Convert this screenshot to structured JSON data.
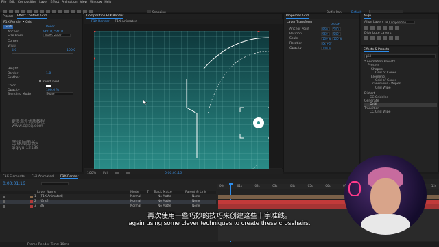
{
  "menu": [
    "File",
    "Edit",
    "Composition",
    "Layer",
    "Effect",
    "Animation",
    "View",
    "Window",
    "Help"
  ],
  "toolbar": {
    "snapping": "Snapping",
    "workspace": "Buffer Pan",
    "search": "search",
    "default_label": "Default"
  },
  "effects_panel": {
    "tabs": [
      "Project",
      "Effect Controls Grid"
    ],
    "header": "F1X Render • Grid",
    "reset": "Reset",
    "rows": [
      {
        "label": "Grid",
        "value": "Reset",
        "accent": true
      },
      {
        "label": "Anchor",
        "value": "960.0, 540.0"
      },
      {
        "label": "Size From",
        "value": "Width Slider"
      },
      {
        "label": "Corner",
        "value": ""
      },
      {
        "label": "Width",
        "value": "100.0"
      },
      {
        "label": "",
        "value": "4.0"
      },
      {
        "label": "Height",
        "value": ""
      },
      {
        "label": "Border",
        "value": "1.0"
      },
      {
        "label": "Feather",
        "value": ""
      },
      {
        "label": "",
        "value": "Invert Grid"
      },
      {
        "label": "Color",
        "value": ""
      },
      {
        "label": "Opacity",
        "value": "100.0 %"
      },
      {
        "label": "Blending Mode",
        "value": "None"
      }
    ]
  },
  "watermark": {
    "line1": "更多海外优质教程",
    "line2": "www.cgltg.com",
    "line3": "团课加团长v",
    "line4": "qiqiyu-12138"
  },
  "comp_viewer": {
    "title": "Composition F1X Render",
    "tabs": [
      "F1X Render",
      "F1X Animated"
    ],
    "zoom": "100%",
    "quality": "Full",
    "timecode": "0;00;01;16"
  },
  "properties": {
    "title": "Properties Grid",
    "section": "Layer Transform",
    "reset": "Reset",
    "rows": [
      {
        "label": "Anchor Point",
        "v1": "960",
        "v2": "540"
      },
      {
        "label": "Position",
        "v1": "960",
        "v2": "540"
      },
      {
        "label": "Scale",
        "v1": "100 %",
        "v2": "100 %"
      },
      {
        "label": "Rotation",
        "v1": "0x +0°",
        "v2": ""
      },
      {
        "label": "Opacity",
        "v1": "100 %",
        "v2": ""
      }
    ]
  },
  "align": {
    "title": "Align",
    "align_to_label": "Align Layers to:",
    "align_to": "Composition",
    "distribute": "Distribute Layers:"
  },
  "effects_presets": {
    "title": "Effects & Presets",
    "search": "grid",
    "items": [
      {
        "label": "* Animation Presets",
        "indent": 0
      },
      {
        "label": "Presets",
        "indent": 1
      },
      {
        "label": "Shapes",
        "indent": 2
      },
      {
        "label": "Grid of Cones",
        "indent": 3
      },
      {
        "label": "Elements",
        "indent": 2
      },
      {
        "label": "Grid of Cones",
        "indent": 3
      },
      {
        "label": "Transitions - Wipes",
        "indent": 2
      },
      {
        "label": "Grid Wipe",
        "indent": 3
      },
      {
        "label": "Distort",
        "indent": 0
      },
      {
        "label": "CC Griddler",
        "indent": 1
      },
      {
        "label": "Generate",
        "indent": 0
      },
      {
        "label": "Grid",
        "indent": 1,
        "selected": true
      },
      {
        "label": "Transition",
        "indent": 0
      },
      {
        "label": "CC Grid Wipe",
        "indent": 1
      }
    ]
  },
  "timeline": {
    "tabs": [
      "F1X Elements",
      "F1X Animated",
      "F1X Render"
    ],
    "timecode": "0:00:01:16",
    "columns": [
      "Layer Name",
      "Mode",
      "T",
      "Track Matte",
      "Parent & Link"
    ],
    "layers": [
      {
        "num": "1",
        "name": "[F1X Animated]",
        "mode": "Normal",
        "matte": "No Matte",
        "parent": "None",
        "color": "#8c6a4a"
      },
      {
        "num": "2",
        "name": "[Grid]",
        "mode": "Normal",
        "matte": "No Matte",
        "parent": "None",
        "color": "#b03a3a"
      },
      {
        "num": "3",
        "name": "BG",
        "mode": "Normal",
        "matte": "No Matte",
        "parent": "None",
        "color": "#b03a3a"
      }
    ],
    "ruler": [
      "00s",
      "01s",
      "02s",
      "03s",
      "04s",
      "05s",
      "06s",
      "07s",
      "08s",
      "09s",
      "10s",
      "11s",
      "12s"
    ],
    "footer": "Frame Render Time: 10ms"
  },
  "subtitles": {
    "zh": "再次使用一些巧妙的技巧来创建这些十字准线。",
    "en": "again using some clever techniques to create these crosshairs."
  },
  "colors": {
    "accent": "#2d8ceb",
    "canvas_top": "#0f3a3d",
    "canvas_bottom": "#2d9a93",
    "grid_line": "#8fd6cf",
    "track_red": "#c23a3a"
  }
}
